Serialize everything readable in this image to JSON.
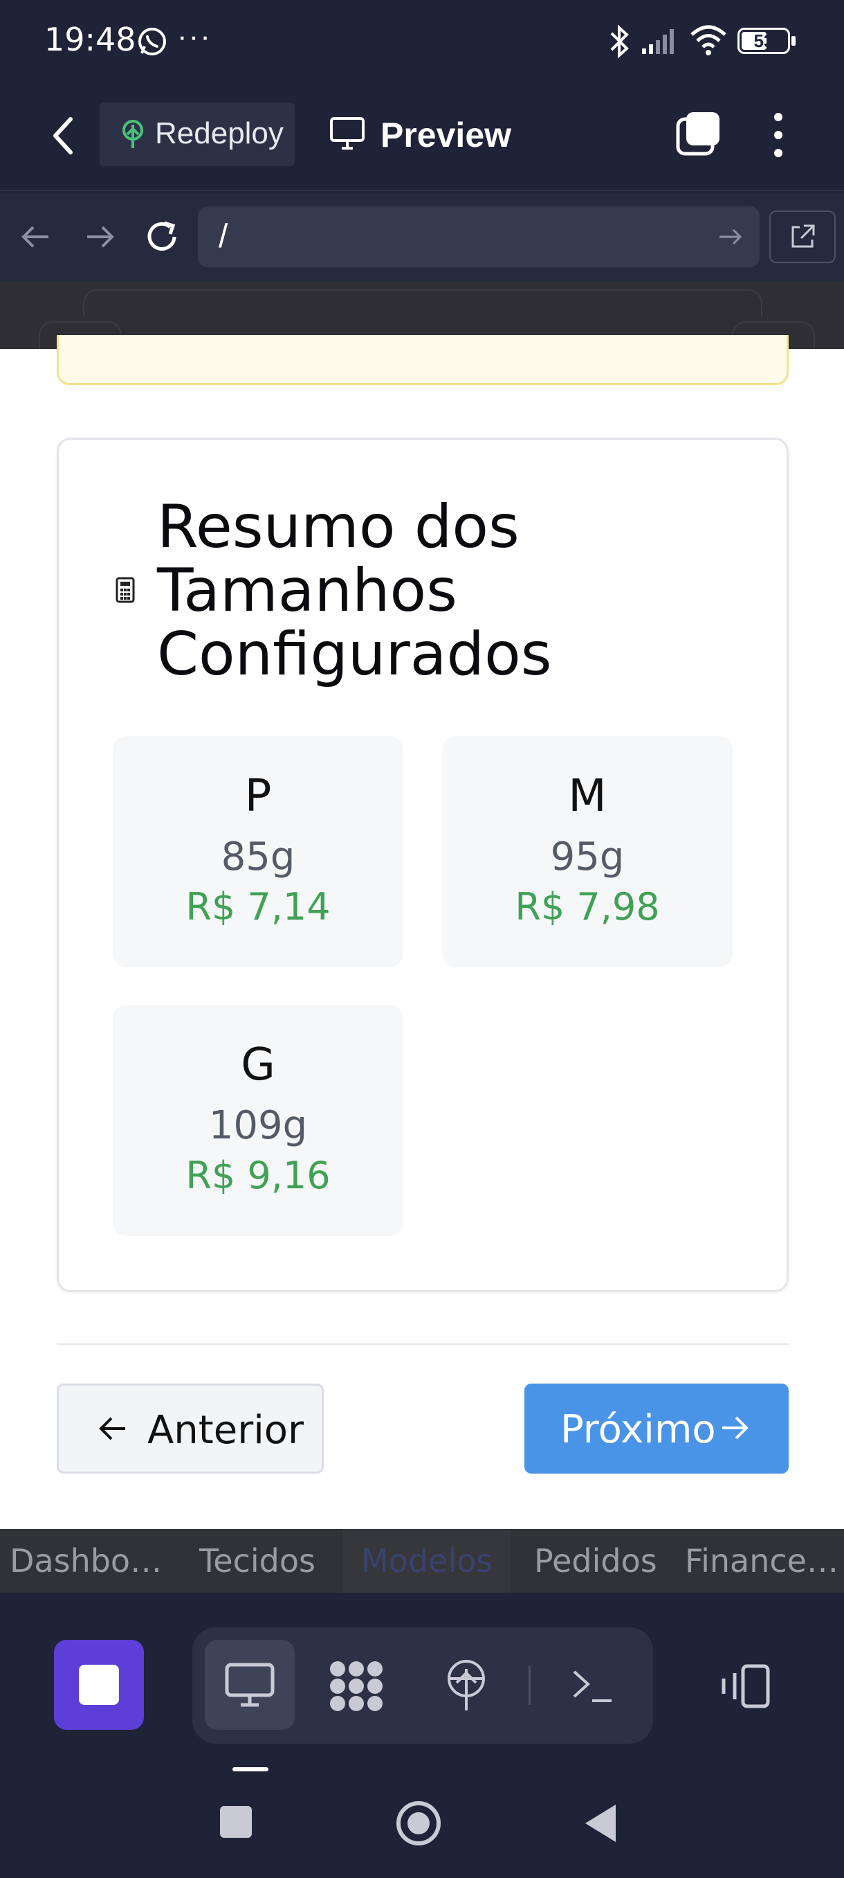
{
  "status_bar": {
    "time": "19:48",
    "battery": "53"
  },
  "header": {
    "redeploy_label": "Redeploy",
    "preview_label": "Preview"
  },
  "browser": {
    "url": "/"
  },
  "summary": {
    "title": "Resumo dos Tamanhos Configurados",
    "sizes": [
      {
        "name": "P",
        "weight": "85g",
        "price": "R$ 7,14"
      },
      {
        "name": "M",
        "weight": "95g",
        "price": "R$ 7,98"
      },
      {
        "name": "G",
        "weight": "109g",
        "price": "R$ 9,16"
      }
    ]
  },
  "nav_buttons": {
    "previous": "Anterior",
    "next": "Próximo"
  },
  "tabs": [
    "Dashbo…",
    "Tecidos",
    "Modelos",
    "Pedidos",
    "Finance…"
  ],
  "colors": {
    "accent": "#4a94e8",
    "price": "#41a155",
    "stop": "#5b3fd6"
  }
}
